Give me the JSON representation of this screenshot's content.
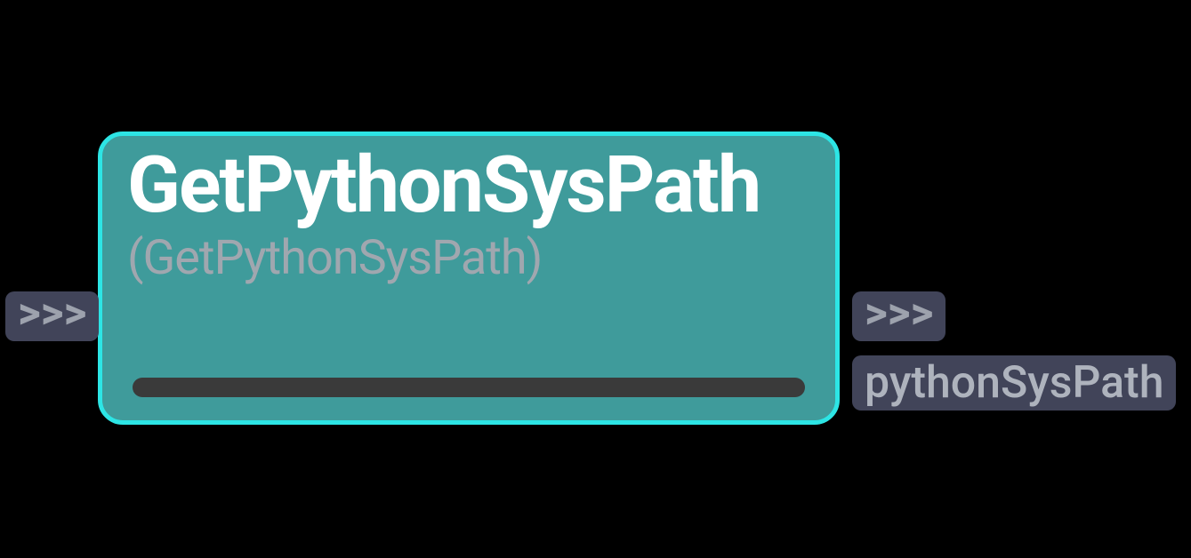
{
  "node": {
    "title": "GetPythonSysPath",
    "subtitle": "(GetPythonSysPath)"
  },
  "ports": {
    "input_flow": ">>>",
    "output_flow": ">>>",
    "output_data": "pythonSysPath"
  }
}
